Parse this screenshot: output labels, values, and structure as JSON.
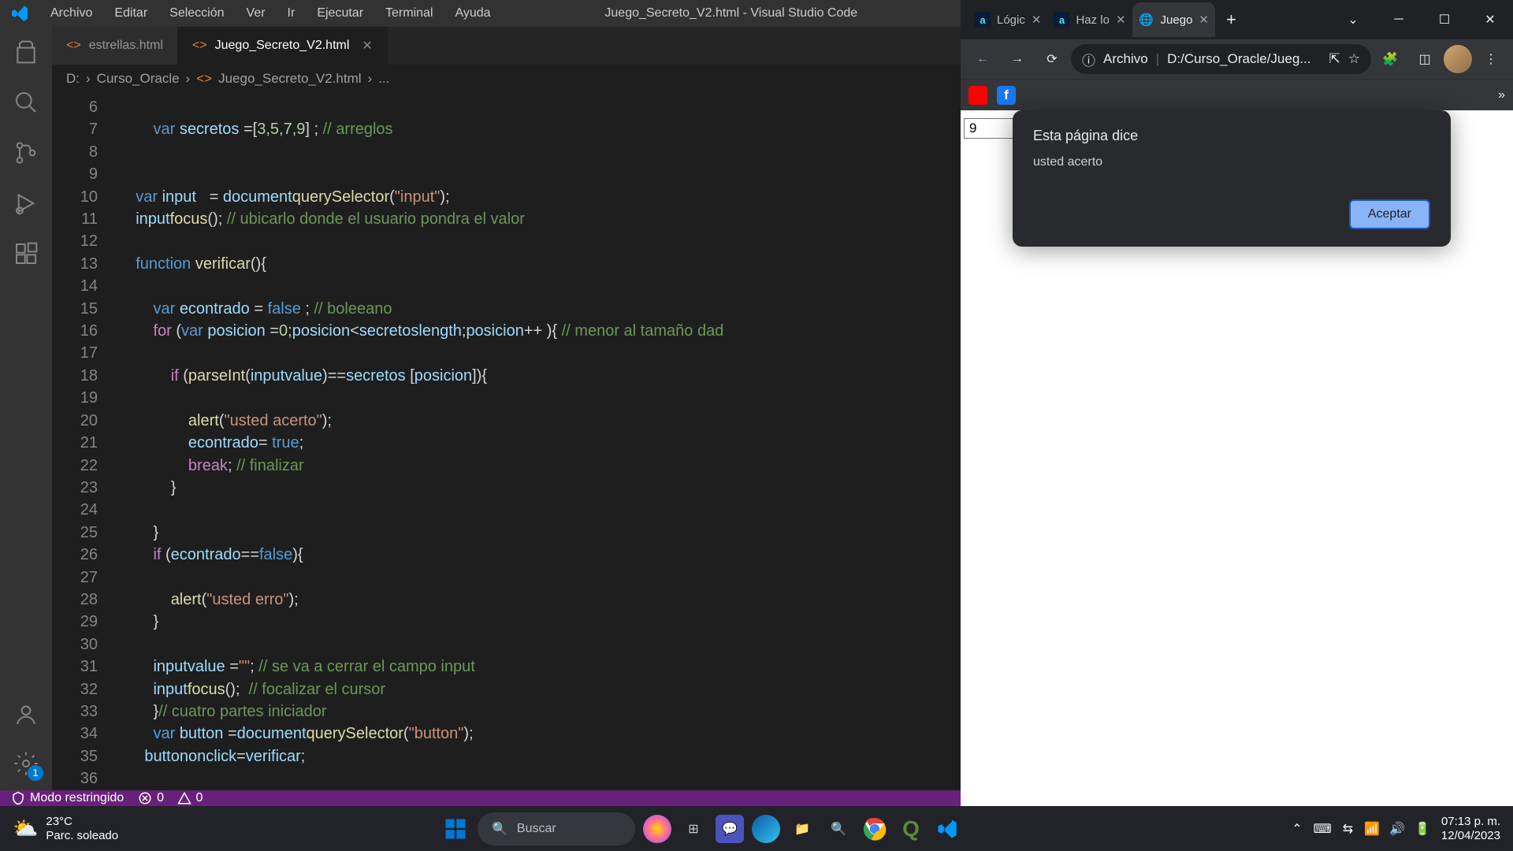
{
  "vscode": {
    "menu": [
      "Archivo",
      "Editar",
      "Selección",
      "Ver",
      "Ir",
      "Ejecutar",
      "Terminal",
      "Ayuda"
    ],
    "title": "Juego_Secreto_V2.html - Visual Studio Code",
    "tabs": {
      "inactive": "estrellas.html",
      "active": "Juego_Secreto_V2.html"
    },
    "breadcrumb": {
      "drive": "D:",
      "folder": "Curso_Oracle",
      "file": "Juego_Secreto_V2.html",
      "more": "..."
    },
    "settings_badge": "1",
    "code": {
      "start": 7,
      "l6": {
        "indent": "        ",
        "kw": "var",
        "sp": " ",
        "v": "secretos",
        "eq": " =",
        "br": "[",
        "n": "3,5,7,9",
        "br2": "] ; ",
        "cm": "// arreglos"
      },
      "l10": {
        "kw": "var",
        "sp": " ",
        "v": "input",
        "pad": "   = ",
        "obj": "document",
        ".": ".",
        "fn": "querySelector",
        "p": "(",
        "s": "\"input\"",
        "p2": ");"
      },
      "l11": {
        "v": "input",
        ".": ".",
        "fn": "focus",
        "p": "(); ",
        "cm": "// ubicarlo donde el usuario pondra el valor"
      },
      "l13": {
        "kw": "function",
        "sp": " ",
        "fn": "verificar",
        "p": "(){"
      },
      "l15": {
        "kw": "var",
        "sp": " ",
        "v": "econtrado",
        "eq": " = ",
        "b": "false",
        "end": " ; ",
        "cm": "// boleeano"
      },
      "l16": {
        "for": "for",
        "p": " (",
        "kw": "var",
        "sp": " ",
        "v": "posicion",
        "eq": " =",
        "n": "0",
        ";": ";",
        "v2": "posicion",
        "lt": "<",
        "v3": "secretos",
        ".": ".",
        "prop": "length",
        ";2": ";",
        "v4": "posicion",
        "pp": "++",
        "end": " ){ ",
        "cm": "// menor al tamaño dad"
      },
      "l18": {
        "if": "if",
        "p": " (",
        "fn": "parseInt",
        "p2": "(",
        "v": "input",
        ".": ".",
        "prop": "value",
        "p3": ")==",
        "v2": "secretos",
        "sp": " [",
        "v3": "posicion",
        "p4": "]){"
      },
      "l20": {
        "fn": "alert",
        "p": "(",
        "s": "\"usted acerto\"",
        "p2": ");"
      },
      "l21": {
        "v": "econtrado",
        "eq": "= ",
        "b": "true",
        "end": ";"
      },
      "l22": {
        "br": "break",
        "end": "; ",
        "cm": "// finalizar"
      },
      "l23": "}",
      "l25": "}",
      "l26": {
        "if": "if",
        "p": " (",
        "v": "econtrado",
        "eq": "==",
        "b": "false",
        "p2": "){"
      },
      "l28": {
        "fn": "alert",
        "p": "(",
        "s": "\"usted erro\"",
        "p2": ");"
      },
      "l29": "}",
      "l31": {
        "v": "input",
        ".": ".",
        "prop": "value",
        "eq": " =",
        "s": "\"\"",
        "end": "; ",
        "cm": "// se va a cerrar el campo input"
      },
      "l32": {
        "v": "input",
        ".": ".",
        "fn": "focus",
        "p": "();  ",
        "cm": "// focalizar el cursor"
      },
      "l33": {
        "end": "}",
        "cm": "// cuatro partes iniciador"
      },
      "l34": {
        "kw": "var",
        "sp": " ",
        "v": "button",
        "eq": " =",
        "obj": "document",
        ".": ".",
        "fn": "querySelector",
        "p": "(",
        "s": "\"button\"",
        "p2": ");"
      },
      "l35": {
        "v": "button",
        ".": ".",
        "prop": "onclick",
        "eq": "=",
        "v2": "verificar",
        "end": ";"
      }
    },
    "status": {
      "restricted": "Modo restringido",
      "errors": "0",
      "warnings": "0"
    }
  },
  "chrome": {
    "tabs": [
      {
        "t": "Lógic",
        "a": false
      },
      {
        "t": "Haz lo",
        "a": false
      },
      {
        "t": "Juego",
        "a": true
      }
    ],
    "omnibox": {
      "prefix": "Archivo",
      "sep": "|",
      "path": "D:/Curso_Oracle/Jueg..."
    },
    "page_input_value": "9",
    "dialog": {
      "title": "Esta página dice",
      "message": "usted acerto",
      "button": "Aceptar"
    }
  },
  "taskbar": {
    "temp": "23°C",
    "cond": "Parc. soleado",
    "search": "Buscar",
    "time": "07:13 p. m.",
    "date": "12/04/2023"
  }
}
